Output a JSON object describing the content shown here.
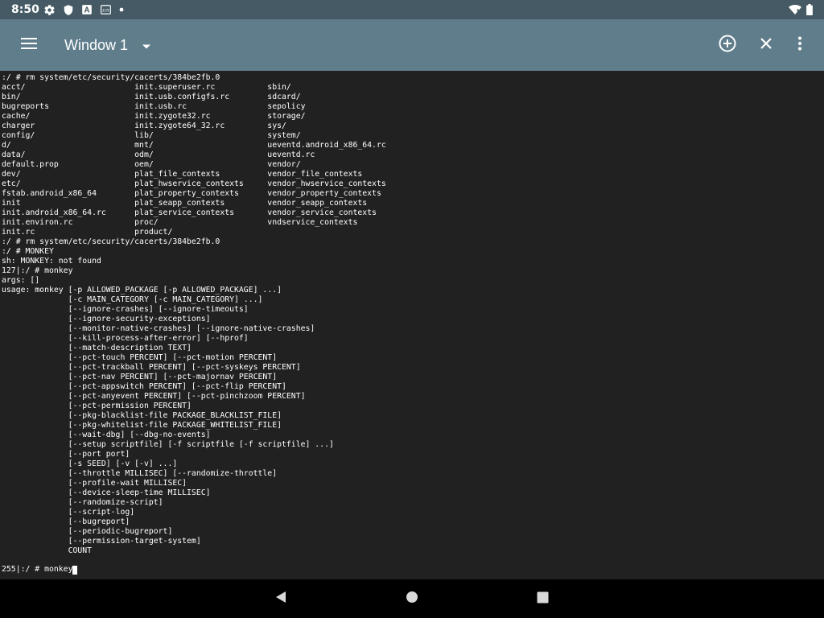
{
  "status_bar": {
    "time": "8:50",
    "icons": [
      "gear-icon",
      "shield-icon",
      "font-a-icon",
      "keyboard-icon",
      "dot-icon"
    ],
    "right_icons": [
      "wifi-icon",
      "battery-icon"
    ]
  },
  "toolbar": {
    "menu_icon": "hamburger-icon",
    "window_title": "Window 1",
    "dropdown_icon": "chevron-down-icon",
    "actions": [
      "add-circle-icon",
      "close-icon",
      "more-vert-icon"
    ],
    "background_color": "#607d8b"
  },
  "terminal": {
    "lines": [
      ":/ # rm system/etc/security/cacerts/384be2fb.0",
      "acct/                       init.superuser.rc           sbin/",
      "bin/                        init.usb.configfs.rc        sdcard/",
      "bugreports                  init.usb.rc                 sepolicy",
      "cache/                      init.zygote32.rc            storage/",
      "charger                     init.zygote64_32.rc         sys/",
      "config/                     lib/                        system/",
      "d/                          mnt/                        ueventd.android_x86_64.rc",
      "data/                       odm/                        ueventd.rc",
      "default.prop                oem/                        vendor/",
      "dev/                        plat_file_contexts          vendor_file_contexts",
      "etc/                        plat_hwservice_contexts     vendor_hwservice_contexts",
      "fstab.android_x86_64        plat_property_contexts      vendor_property_contexts",
      "init                        plat_seapp_contexts         vendor_seapp_contexts",
      "init.android_x86_64.rc      plat_service_contexts       vendor_service_contexts",
      "init.environ.rc             proc/                       vndservice_contexts",
      "init.rc                     product/",
      ":/ # rm system/etc/security/cacerts/384be2fb.0",
      ":/ # MONKEY",
      "sh: MONKEY: not found",
      "127|:/ # monkey",
      "args: []",
      "usage: monkey [-p ALLOWED_PACKAGE [-p ALLOWED_PACKAGE] ...]",
      "              [-c MAIN_CATEGORY [-c MAIN_CATEGORY] ...]",
      "              [--ignore-crashes] [--ignore-timeouts]",
      "              [--ignore-security-exceptions]",
      "              [--monitor-native-crashes] [--ignore-native-crashes]",
      "              [--kill-process-after-error] [--hprof]",
      "              [--match-description TEXT]",
      "              [--pct-touch PERCENT] [--pct-motion PERCENT]",
      "              [--pct-trackball PERCENT] [--pct-syskeys PERCENT]",
      "              [--pct-nav PERCENT] [--pct-majornav PERCENT]",
      "              [--pct-appswitch PERCENT] [--pct-flip PERCENT]",
      "              [--pct-anyevent PERCENT] [--pct-pinchzoom PERCENT]",
      "              [--pct-permission PERCENT]",
      "              [--pkg-blacklist-file PACKAGE_BLACKLIST_FILE]",
      "              [--pkg-whitelist-file PACKAGE_WHITELIST_FILE]",
      "              [--wait-dbg] [--dbg-no-events]",
      "              [--setup scriptfile] [-f scriptfile [-f scriptfile] ...]",
      "              [--port port]",
      "              [-s SEED] [-v [-v] ...]",
      "              [--throttle MILLISEC] [--randomize-throttle]",
      "              [--profile-wait MILLISEC]",
      "              [--device-sleep-time MILLISEC]",
      "              [--randomize-script]",
      "              [--script-log]",
      "              [--bugreport]",
      "              [--periodic-bugreport]",
      "              [--permission-target-system]",
      "              COUNT"
    ],
    "prompt": "255|:/ # monkey",
    "text_color": "#ffffff",
    "background_color": "#212121"
  },
  "nav_bar": {
    "buttons": [
      "back-icon",
      "home-icon",
      "recents-icon"
    ]
  }
}
